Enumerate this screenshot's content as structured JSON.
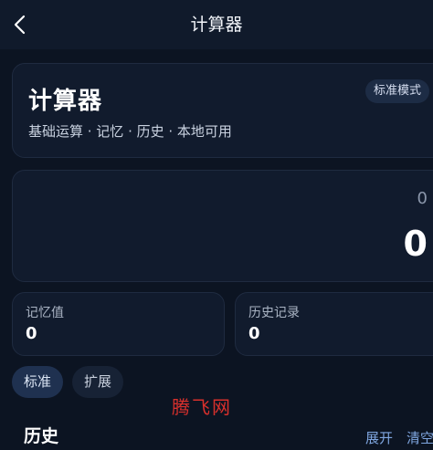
{
  "header": {
    "title": "计算器",
    "back_icon": "chevron-left-icon"
  },
  "info_card": {
    "title": "计算器",
    "subtitle": "基础运算 · 记忆 · 历史 · 本地可用",
    "mode_badge": "标准模式"
  },
  "display": {
    "expression": "0",
    "result": "0"
  },
  "stats": {
    "memory_label": "记忆值",
    "memory_value": "0",
    "history_label": "历史记录",
    "history_value": "0"
  },
  "mode_tabs": [
    {
      "label": "标准",
      "selected": true
    },
    {
      "label": "扩展",
      "selected": false
    }
  ],
  "watermark": "腾飞网",
  "history": {
    "title": "历史",
    "expand_label": "展开",
    "clear_label": "清空"
  },
  "colors": {
    "background": "#0c1422",
    "card": "#111b2d",
    "accent_link": "#7fa6e0",
    "watermark": "#d9302c"
  }
}
